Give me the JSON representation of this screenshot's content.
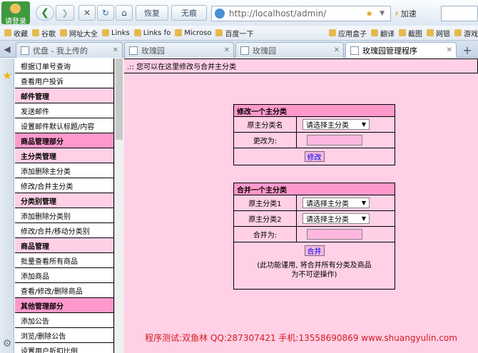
{
  "browser": {
    "login_label": "请登录",
    "restore_label": "恢复",
    "noad_label": "无痕",
    "address": "http://localhost/admin/",
    "accel_label": "加速"
  },
  "favorites": [
    {
      "label": "收藏"
    },
    {
      "label": "谷歌"
    },
    {
      "label": "网址大全"
    },
    {
      "label": "Links"
    },
    {
      "label": "Links fo"
    },
    {
      "label": "Microso"
    },
    {
      "label": "百度一下"
    },
    {
      "label": "应用盒子"
    },
    {
      "label": "翻译"
    },
    {
      "label": "截图"
    },
    {
      "label": "网银"
    },
    {
      "label": "游戏"
    }
  ],
  "tabs": [
    {
      "label": "优盘 - 我上传的"
    },
    {
      "label": "玫瑰园"
    },
    {
      "label": "玫瑰园"
    },
    {
      "label": "玫瑰园管理程序"
    }
  ],
  "menu": [
    {
      "label": "根据订单号查询",
      "type": "item"
    },
    {
      "label": "查看用户投诉",
      "type": "item"
    },
    {
      "label": "邮件管理",
      "type": "head"
    },
    {
      "label": "发送邮件",
      "type": "item"
    },
    {
      "label": "设置邮件默认标题/内容",
      "type": "item"
    },
    {
      "label": "商品管理部分",
      "type": "section"
    },
    {
      "label": "主分类管理",
      "type": "head"
    },
    {
      "label": "添加删除主分类",
      "type": "item"
    },
    {
      "label": "修改/合并主分类",
      "type": "item"
    },
    {
      "label": "分类别管理",
      "type": "head"
    },
    {
      "label": "添加删除分类别",
      "type": "item"
    },
    {
      "label": "修改/合并/移动分类别",
      "type": "item"
    },
    {
      "label": "商品管理",
      "type": "head"
    },
    {
      "label": "批量查看所有商品",
      "type": "item"
    },
    {
      "label": "添加商品",
      "type": "item"
    },
    {
      "label": "查看/修改/删除商品",
      "type": "item"
    },
    {
      "label": "其他管理部分",
      "type": "section"
    },
    {
      "label": "添加公告",
      "type": "item"
    },
    {
      "label": "浏览/删除公告",
      "type": "item"
    },
    {
      "label": "设置用户折扣比例",
      "type": "item"
    }
  ],
  "notice": ".:: 您可以在这里修改与合并主分类",
  "modify": {
    "title": "修改一个主分类",
    "orig_label": "原主分类名",
    "select_value": "请选择主分类",
    "change_label": "更改为:",
    "button": "修改"
  },
  "merge": {
    "title": "合并一个主分类",
    "label1": "原主分类1",
    "label2": "原主分类2",
    "select1_value": "请选择主分类",
    "select2_value": "请选择主分类",
    "merge_to_label": "合并为:",
    "button": "合并",
    "warning_line1": "(此功能谨用, 将合并所有分类及商品",
    "warning_line2": "为不可逆操作)"
  },
  "footer": "程序测试:双鱼林 QQ:287307421 手机:13558690869 www.shuangyulin.com",
  "colors": {
    "content_bg": "#ffd0e6",
    "header_bg": "#ff99cc",
    "footer_text": "#d21c1c"
  }
}
